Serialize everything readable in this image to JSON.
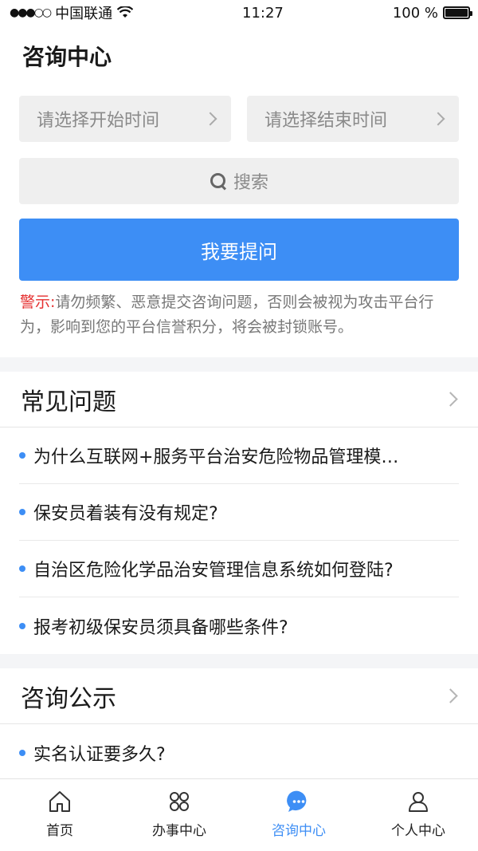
{
  "status_bar": {
    "carrier": "中国联通",
    "signal": "●●●○○",
    "time": "11:27",
    "battery": "100 %"
  },
  "header": {
    "title": "咨询中心"
  },
  "filters": {
    "start_placeholder": "请选择开始时间",
    "end_placeholder": "请选择结束时间",
    "search_label": "搜索"
  },
  "ask_button": "我要提问",
  "warning": {
    "label": "警示:",
    "text": "请勿频繁、恶意提交咨询问题，否则会被视为攻击平台行为，影响到您的平台信誉积分，将会被封锁账号。"
  },
  "faq": {
    "title": "常见问题",
    "items": [
      "为什么互联网+服务平台治安危险物品管理模…",
      "保安员着装有没有规定?",
      "自治区危险化学品治安管理信息系统如何登陆?",
      "报考初级保安员须具备哪些条件?"
    ]
  },
  "announcements": {
    "title": "咨询公示",
    "items": [
      "实名认证要多久?"
    ]
  },
  "tabbar": {
    "tabs": [
      {
        "label": "首页",
        "icon": "home-icon"
      },
      {
        "label": "办事中心",
        "icon": "services-icon"
      },
      {
        "label": "咨询中心",
        "icon": "chat-icon"
      },
      {
        "label": "个人中心",
        "icon": "user-icon"
      }
    ],
    "active_index": 2
  },
  "colors": {
    "accent": "#3d8ef5",
    "warning": "#e53030"
  }
}
